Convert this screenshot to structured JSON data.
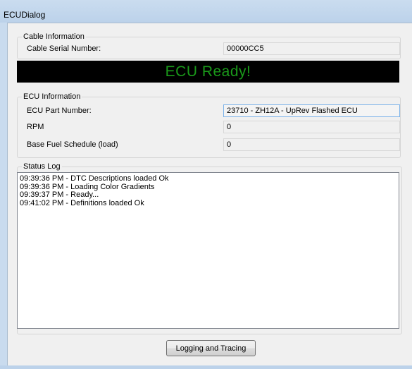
{
  "window": {
    "title": "ECUDialog"
  },
  "cable": {
    "group_label": "Cable Information",
    "serial_label": "Cable Serial Number:",
    "serial_value": "00000CC5"
  },
  "banner": {
    "text": "ECU Ready!",
    "color": "#1a9a1a",
    "background": "#000000"
  },
  "ecu": {
    "group_label": "ECU Information",
    "part_number_label": "ECU Part Number:",
    "part_number_value": "23710 - ZH12A - UpRev Flashed ECU",
    "rpm_label": "RPM",
    "rpm_value": "0",
    "fuel_label": "Base Fuel Schedule (load)",
    "fuel_value": "0"
  },
  "status_log": {
    "group_label": "Status Log",
    "lines": [
      "09:39:36 PM - DTC Descriptions loaded Ok",
      "09:39:36 PM - Loading Color Gradients",
      "09:39:37 PM - Ready...",
      "09:41:02 PM - Definitions loaded Ok"
    ]
  },
  "buttons": {
    "logging_label": "Logging and Tracing"
  }
}
